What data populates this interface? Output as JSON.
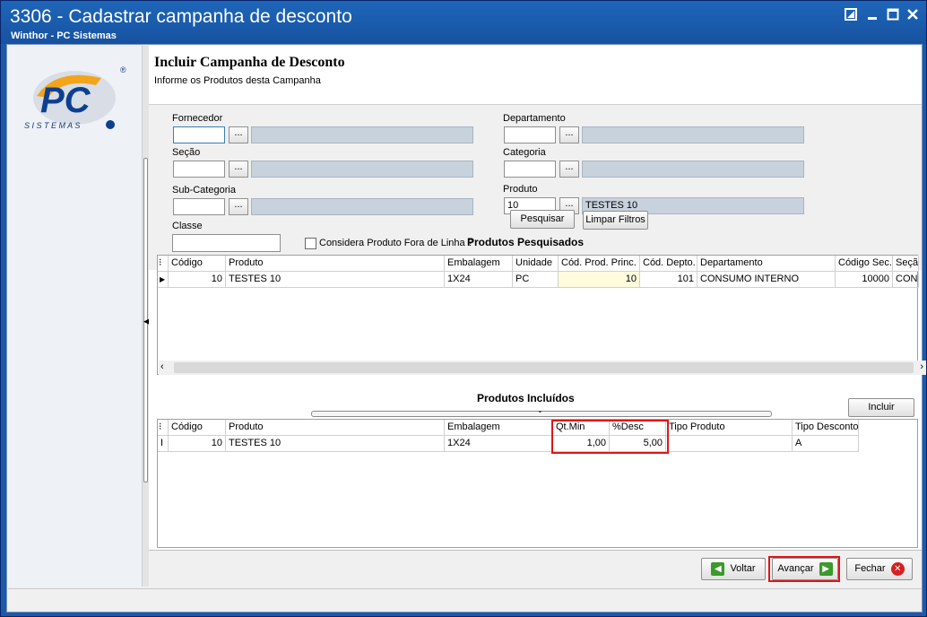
{
  "window": {
    "title": "3306 - Cadastrar campanha de desconto",
    "subtitle": "Winthor - PC Sistemas"
  },
  "logo": {
    "brand": "PC",
    "tagline": "S I S T E M A S",
    "registered": "®"
  },
  "page": {
    "title": "Incluir Campanha de Desconto",
    "subtitle": "Informe os Produtos desta Campanha"
  },
  "filters": {
    "fornecedor": {
      "label": "Fornecedor",
      "value": "",
      "desc": ""
    },
    "secao": {
      "label": "Seção",
      "value": "",
      "desc": ""
    },
    "subcategoria": {
      "label": "Sub-Categoria",
      "value": "",
      "desc": ""
    },
    "classe": {
      "label": "Classe",
      "value": ""
    },
    "departamento": {
      "label": "Departamento",
      "value": "",
      "desc": ""
    },
    "categoria": {
      "label": "Categoria",
      "value": "",
      "desc": ""
    },
    "produto": {
      "label": "Produto",
      "value": "10",
      "desc": "TESTES 10"
    },
    "fora_de_linha": {
      "label": "Considera Produto Fora de Linha ?",
      "checked": false
    },
    "dots": "...",
    "pesquisar": "Pesquisar",
    "limpar": "Limpar Filtros"
  },
  "pesquisados": {
    "title": "Produtos Pesquisados",
    "columns": [
      "Código",
      "Produto",
      "Embalagem",
      "Unidade",
      "Cód. Prod. Princ.",
      "Cód. Depto.",
      "Departamento",
      "Código Sec.",
      "Seção"
    ],
    "rows": [
      [
        "10",
        "TESTES 10",
        "1X24",
        "PC",
        "10",
        "101",
        "CONSUMO INTERNO",
        "10000",
        "CONSU"
      ]
    ]
  },
  "incluidos": {
    "title": "Produtos Incluídos",
    "incluir": "Incluir",
    "columns": [
      "Código",
      "Produto",
      "Embalagem",
      "Qt.Min",
      "%Desc",
      "Tipo Produto",
      "Tipo Desconto"
    ],
    "rows": [
      [
        "10",
        "TESTES 10",
        "1X24",
        "1,00",
        "5,00",
        "",
        "A"
      ]
    ]
  },
  "footer": {
    "voltar": "Voltar",
    "avancar": "Avançar",
    "fechar": "Fechar"
  }
}
